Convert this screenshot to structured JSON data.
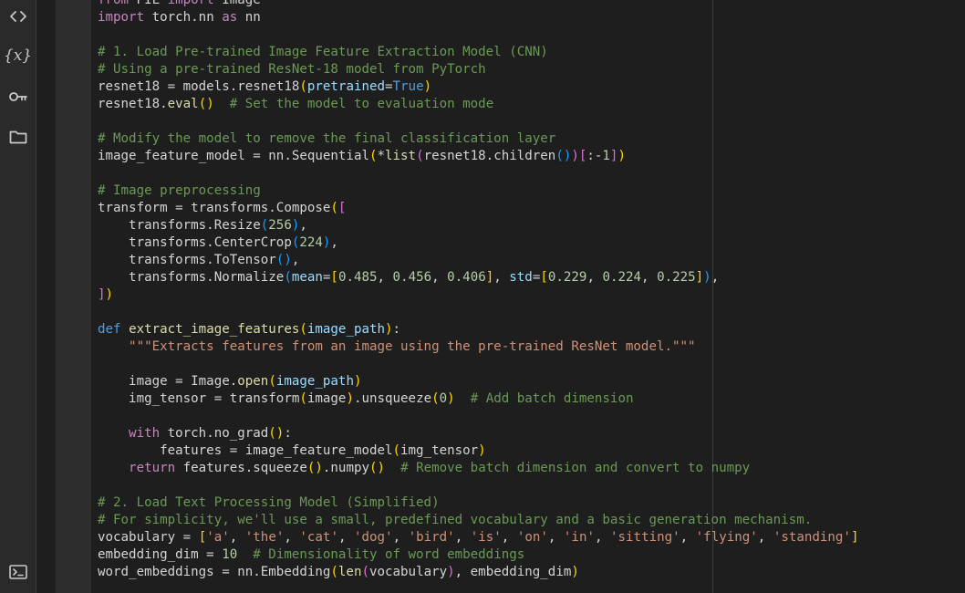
{
  "sidebar": {
    "icons": [
      {
        "name": "code-icon"
      },
      {
        "name": "variables-icon",
        "glyph": "{x}"
      },
      {
        "name": "key-icon"
      },
      {
        "name": "folder-icon"
      },
      {
        "name": "terminal-icon"
      }
    ]
  },
  "editor": {
    "lines": [
      [
        [
          "keyword",
          "from"
        ],
        [
          "default",
          " PIL "
        ],
        [
          "keyword",
          "import"
        ],
        [
          "default",
          " Image"
        ]
      ],
      [
        [
          "keyword",
          "import"
        ],
        [
          "default",
          " torch.nn "
        ],
        [
          "keyword",
          "as"
        ],
        [
          "default",
          " nn"
        ]
      ],
      [],
      [
        [
          "comment",
          "# 1. Load Pre-trained Image Feature Extraction Model (CNN)"
        ]
      ],
      [
        [
          "comment",
          "# Using a pre-trained ResNet-18 model from PyTorch"
        ]
      ],
      [
        [
          "default",
          "resnet18 = models.resnet18"
        ],
        [
          "b1",
          "("
        ],
        [
          "param",
          "pretrained"
        ],
        [
          "default",
          "="
        ],
        [
          "const",
          "True"
        ],
        [
          "b1",
          ")"
        ]
      ],
      [
        [
          "default",
          "resnet18."
        ],
        [
          "func",
          "eval"
        ],
        [
          "b1",
          "()"
        ],
        [
          "default",
          "  "
        ],
        [
          "comment",
          "# Set the model to evaluation mode"
        ]
      ],
      [],
      [
        [
          "comment",
          "# Modify the model to remove the final classification layer"
        ]
      ],
      [
        [
          "default",
          "image_feature_model = nn.Sequential"
        ],
        [
          "b1",
          "("
        ],
        [
          "default",
          "*"
        ],
        [
          "builtin",
          "list"
        ],
        [
          "b2",
          "("
        ],
        [
          "default",
          "resnet18.children"
        ],
        [
          "b3",
          "()"
        ],
        [
          "b2",
          ")"
        ],
        [
          "b2",
          "["
        ],
        [
          "default",
          ":-"
        ],
        [
          "number",
          "1"
        ],
        [
          "b2",
          "]"
        ],
        [
          "b1",
          ")"
        ]
      ],
      [],
      [
        [
          "comment",
          "# Image preprocessing"
        ]
      ],
      [
        [
          "default",
          "transform = transforms.Compose"
        ],
        [
          "b1",
          "("
        ],
        [
          "b2",
          "["
        ]
      ],
      [
        [
          "default",
          "    transforms.Resize"
        ],
        [
          "b3",
          "("
        ],
        [
          "number",
          "256"
        ],
        [
          "b3",
          ")"
        ],
        [
          "default",
          ","
        ]
      ],
      [
        [
          "default",
          "    transforms.CenterCrop"
        ],
        [
          "b3",
          "("
        ],
        [
          "number",
          "224"
        ],
        [
          "b3",
          ")"
        ],
        [
          "default",
          ","
        ]
      ],
      [
        [
          "default",
          "    transforms.ToTensor"
        ],
        [
          "b3",
          "()"
        ],
        [
          "default",
          ","
        ]
      ],
      [
        [
          "default",
          "    transforms.Normalize"
        ],
        [
          "b3",
          "("
        ],
        [
          "param",
          "mean"
        ],
        [
          "default",
          "="
        ],
        [
          "b1",
          "["
        ],
        [
          "number",
          "0.485"
        ],
        [
          "default",
          ", "
        ],
        [
          "number",
          "0.456"
        ],
        [
          "default",
          ", "
        ],
        [
          "number",
          "0.406"
        ],
        [
          "b1",
          "]"
        ],
        [
          "default",
          ", "
        ],
        [
          "param",
          "std"
        ],
        [
          "default",
          "="
        ],
        [
          "b1",
          "["
        ],
        [
          "number",
          "0.229"
        ],
        [
          "default",
          ", "
        ],
        [
          "number",
          "0.224"
        ],
        [
          "default",
          ", "
        ],
        [
          "number",
          "0.225"
        ],
        [
          "b1",
          "]"
        ],
        [
          "b3",
          ")"
        ],
        [
          "default",
          ","
        ]
      ],
      [
        [
          "b2",
          "]"
        ],
        [
          "b1",
          ")"
        ]
      ],
      [],
      [
        [
          "def",
          "def"
        ],
        [
          "default",
          " "
        ],
        [
          "func",
          "extract_image_features"
        ],
        [
          "b1",
          "("
        ],
        [
          "param",
          "image_path"
        ],
        [
          "b1",
          ")"
        ],
        [
          "default",
          ":"
        ]
      ],
      [
        [
          "string",
          "    \"\"\"Extracts features from an image using the pre-trained ResNet model.\"\"\""
        ]
      ],
      [],
      [
        [
          "default",
          "    image = Image."
        ],
        [
          "func",
          "open"
        ],
        [
          "b1",
          "("
        ],
        [
          "param",
          "image_path"
        ],
        [
          "b1",
          ")"
        ]
      ],
      [
        [
          "default",
          "    img_tensor = transform"
        ],
        [
          "b1",
          "("
        ],
        [
          "default",
          "image"
        ],
        [
          "b1",
          ")"
        ],
        [
          "default",
          ".unsqueeze"
        ],
        [
          "b1",
          "("
        ],
        [
          "number",
          "0"
        ],
        [
          "b1",
          ")"
        ],
        [
          "default",
          "  "
        ],
        [
          "comment",
          "# Add batch dimension"
        ]
      ],
      [],
      [
        [
          "keyword",
          "    with"
        ],
        [
          "default",
          " torch.no_grad"
        ],
        [
          "b1",
          "()"
        ],
        [
          "default",
          ":"
        ]
      ],
      [
        [
          "default",
          "        features = image_feature_model"
        ],
        [
          "b1",
          "("
        ],
        [
          "default",
          "img_tensor"
        ],
        [
          "b1",
          ")"
        ]
      ],
      [
        [
          "keyword",
          "    return"
        ],
        [
          "default",
          " features.squeeze"
        ],
        [
          "b1",
          "()"
        ],
        [
          "default",
          ".numpy"
        ],
        [
          "b1",
          "()"
        ],
        [
          "default",
          "  "
        ],
        [
          "comment",
          "# Remove batch dimension and convert to numpy"
        ]
      ],
      [],
      [
        [
          "comment",
          "# 2. Load Text Processing Model (Simplified)"
        ]
      ],
      [
        [
          "comment",
          "# For simplicity, we'll use a small, predefined vocabulary and a basic generation mechanism."
        ]
      ],
      [
        [
          "default",
          "vocabulary = "
        ],
        [
          "b1",
          "["
        ],
        [
          "string",
          "'a'"
        ],
        [
          "default",
          ", "
        ],
        [
          "string",
          "'the'"
        ],
        [
          "default",
          ", "
        ],
        [
          "string",
          "'cat'"
        ],
        [
          "default",
          ", "
        ],
        [
          "string",
          "'dog'"
        ],
        [
          "default",
          ", "
        ],
        [
          "string",
          "'bird'"
        ],
        [
          "default",
          ", "
        ],
        [
          "string",
          "'is'"
        ],
        [
          "default",
          ", "
        ],
        [
          "string",
          "'on'"
        ],
        [
          "default",
          ", "
        ],
        [
          "string",
          "'in'"
        ],
        [
          "default",
          ", "
        ],
        [
          "string",
          "'sitting'"
        ],
        [
          "default",
          ", "
        ],
        [
          "string",
          "'flying'"
        ],
        [
          "default",
          ", "
        ],
        [
          "string",
          "'standing'"
        ],
        [
          "b1",
          "]"
        ]
      ],
      [
        [
          "default",
          "embedding_dim = "
        ],
        [
          "number",
          "10"
        ],
        [
          "default",
          "  "
        ],
        [
          "comment",
          "# Dimensionality of word embeddings"
        ]
      ],
      [
        [
          "default",
          "word_embeddings = nn.Embedding"
        ],
        [
          "b1",
          "("
        ],
        [
          "builtin",
          "len"
        ],
        [
          "b2",
          "("
        ],
        [
          "default",
          "vocabulary"
        ],
        [
          "b2",
          ")"
        ],
        [
          "default",
          ", embedding_dim"
        ],
        [
          "b1",
          ")"
        ]
      ]
    ]
  }
}
